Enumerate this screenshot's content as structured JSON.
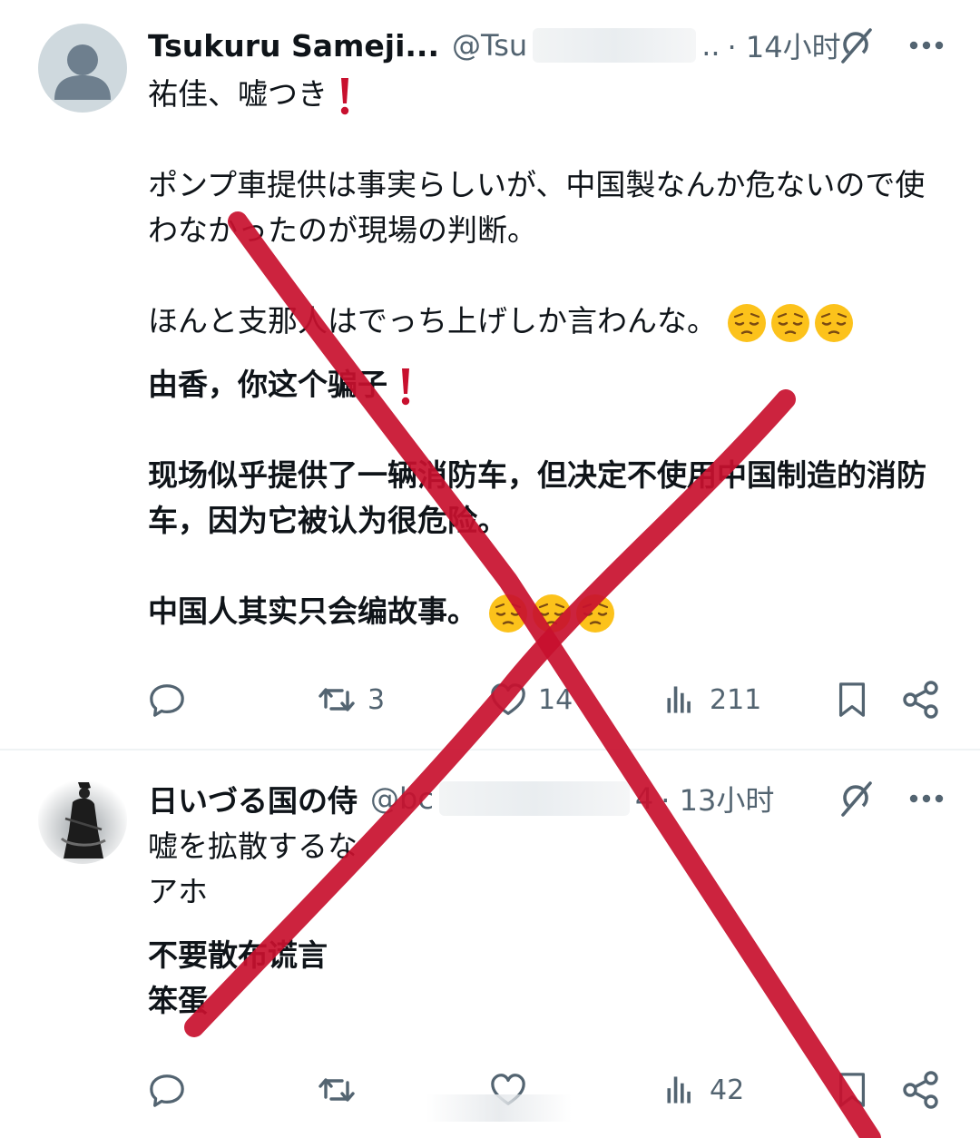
{
  "tweet1": {
    "name": "Tsukuru Sameji...",
    "handle": "@Tsu",
    "handle_tail": "..",
    "time": "· 14小时",
    "avatar_icon": "default-avatar-icon",
    "original_line1": "祐佳、嘘つき",
    "original_line2": "ポンプ車提供は事実らしいが、中国製なんか危ないので使わなかったのが現場の判断。",
    "original_line3": "ほんと支那人はでっち上げしか言わんな。",
    "translated_line1": "由香，你这个骗子",
    "translated_line2": "现场似乎提供了一辆消防车，但决定不使用中国制造的消防车，因为它被认为很危险。",
    "translated_line3": "中国人其实只会编故事。",
    "emoji": "pensive-face-emoji",
    "emphasis_icon": "red-exclamation-icon",
    "actions": {
      "reply_count": "",
      "retweet_count": "3",
      "like_count": "14",
      "views_count": "211"
    }
  },
  "tweet2": {
    "name": "日いづる国の侍",
    "handle": "@bc",
    "handle_tail": "4",
    "time": "· 13小时",
    "avatar_icon": "samurai-avatar-icon",
    "original_line1": "嘘を拡散するな",
    "original_line2": "アホ",
    "translated_line1": "不要散布谎言",
    "translated_line2": "笨蛋",
    "actions": {
      "reply_count": "",
      "retweet_count": "",
      "like_count": "",
      "views_count": "42"
    }
  },
  "overlay": {
    "icon": "red-cross-mark",
    "color": "#c8102e"
  },
  "colors": {
    "text": "#0f1419",
    "secondary": "#536471",
    "divider": "#eff3f4",
    "accent_red": "#c8102e",
    "emoji_yellow": "#fcc21b"
  }
}
